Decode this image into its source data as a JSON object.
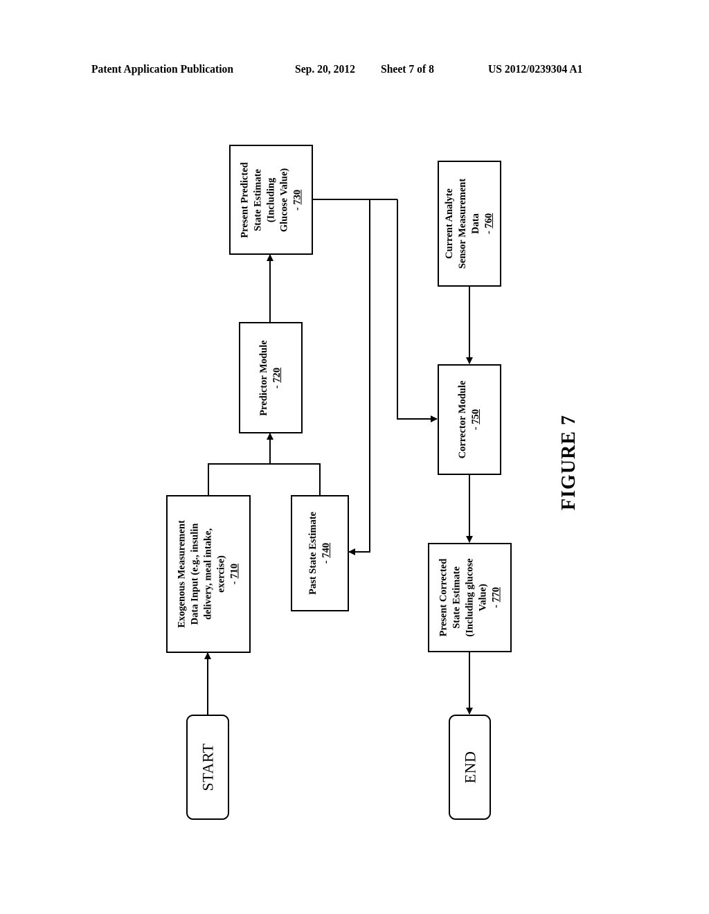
{
  "header": {
    "publication": "Patent Application Publication",
    "date": "Sep. 20, 2012",
    "sheet": "Sheet 7 of 8",
    "number": "US 2012/0239304 A1"
  },
  "figure_label": "FIGURE 7",
  "nodes": {
    "start": {
      "text": "START"
    },
    "end": {
      "text": "END"
    },
    "n710": {
      "lines": [
        "Exogenous Measurement",
        "Data Input (e.g., insulin",
        "delivery, meal intake,",
        "exercise)"
      ],
      "ref": "710"
    },
    "n720": {
      "lines": [
        "Predictor Module"
      ],
      "ref": "720"
    },
    "n730": {
      "lines": [
        "Present Predicted",
        "State Estimate",
        "(Including",
        "Glucose Value)"
      ],
      "ref": "730"
    },
    "n740": {
      "lines": [
        "Past State Estimate"
      ],
      "ref": "740"
    },
    "n750": {
      "lines": [
        "Corrector Module"
      ],
      "ref": "750"
    },
    "n760": {
      "lines": [
        "Current Analyte",
        "Sensor Measurement",
        "Data"
      ],
      "ref": "760"
    },
    "n770": {
      "lines": [
        "Present Corrected",
        "State Estimate",
        "(Including glucose",
        "Value)"
      ],
      "ref": "770"
    }
  },
  "ref_prefix": "- ",
  "edges": [
    {
      "from": "START",
      "to": "710"
    },
    {
      "from": "710",
      "to": "720"
    },
    {
      "from": "740",
      "to": "720"
    },
    {
      "from": "720",
      "to": "730"
    },
    {
      "from": "730",
      "to": "740"
    },
    {
      "from": "730",
      "to": "750"
    },
    {
      "from": "760",
      "to": "750"
    },
    {
      "from": "750",
      "to": "770"
    },
    {
      "from": "770",
      "to": "END"
    }
  ]
}
